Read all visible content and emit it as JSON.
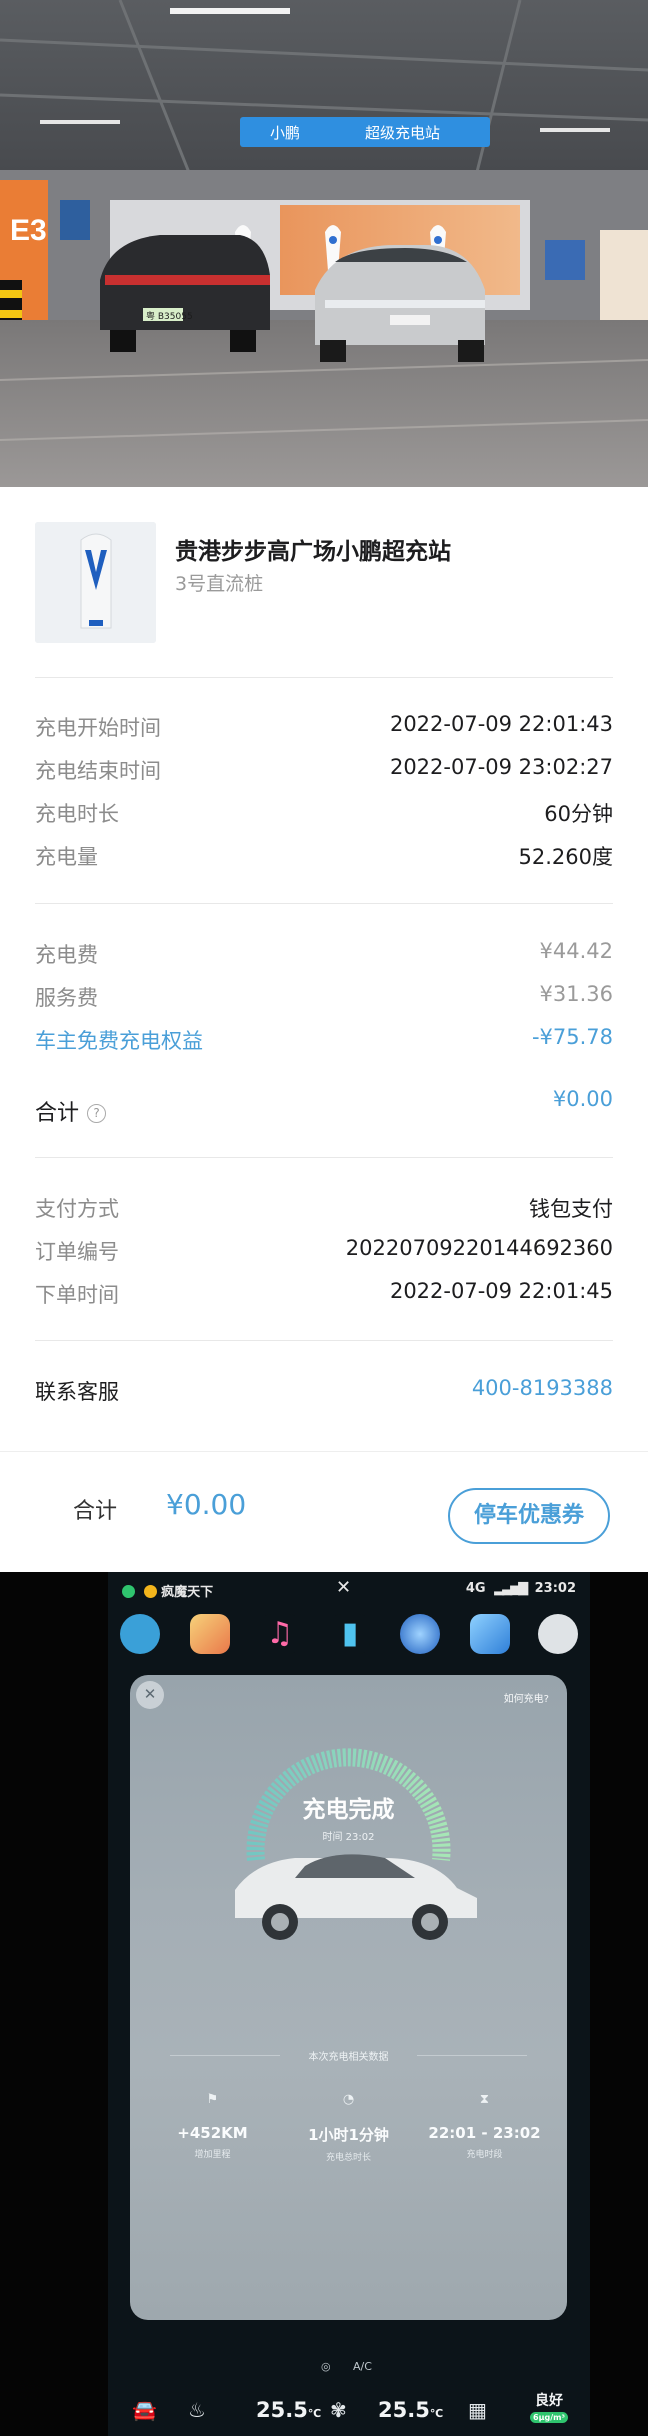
{
  "photo": {
    "brand_sign": "小鹏",
    "station_sign": "超级充电站",
    "bay_label": "E3",
    "license_plate": "粤 B35055"
  },
  "station": {
    "name": "贵港步步高广场小鹏超充站",
    "pile": "3号直流桩"
  },
  "charge": {
    "start_label": "充电开始时间",
    "start_value": "2022-07-09 22:01:43",
    "end_label": "充电结束时间",
    "end_value": "2022-07-09 23:02:27",
    "duration_label": "充电时长",
    "duration_value": "60分钟",
    "energy_label": "充电量",
    "energy_value": "52.260度"
  },
  "fees": {
    "charge_fee_label": "充电费",
    "charge_fee_value": "¥44.42",
    "service_fee_label": "服务费",
    "service_fee_value": "¥31.36",
    "benefit_label": "车主免费充电权益",
    "benefit_value": "-¥75.78",
    "total_label": "合计",
    "total_help_icon": "?",
    "total_value": "¥0.00"
  },
  "payment": {
    "method_label": "支付方式",
    "method_value": "钱包支付",
    "order_no_label": "订单编号",
    "order_no_value": "20220709220144692360",
    "order_time_label": "下单时间",
    "order_time_value": "2022-07-09 22:01:45"
  },
  "support": {
    "label": "联系客服",
    "phone": "400-8193388"
  },
  "bottom_bar": {
    "total_label": "合计",
    "total_amount": "¥0.00",
    "coupon_button": "停车优惠券"
  },
  "car_screen": {
    "status_left": "疯魔天下",
    "status_logo": "✕",
    "status_signal": "4G",
    "status_time": "23:02",
    "panel": {
      "close": "✕",
      "howto": "如何充电?",
      "title": "充电完成",
      "time": "时间 23:02",
      "section_title": "本次充电相关数据",
      "stats": [
        {
          "icon": "flag-icon",
          "glyph": "⚑",
          "value": "+452KM",
          "label": "增加里程"
        },
        {
          "icon": "clock-icon",
          "glyph": "◔",
          "value": "1小时1分钟",
          "label": "充电总时长"
        },
        {
          "icon": "hourglass-icon",
          "glyph": "⧗",
          "value": "22:01 - 23:02",
          "label": "充电时段"
        }
      ]
    },
    "climate": {
      "auto_label": "A/C",
      "left_temp": "25.5",
      "right_temp": "25.5",
      "temp_unit": "℃",
      "air_quality_value": "良好",
      "air_quality_badge": "6μg/m³"
    }
  },
  "colors": {
    "accent_blue": "#4a9fd8",
    "charge_ring_start": "#74c7c2",
    "charge_ring_end": "#a6e6b6",
    "aq_green": "#2fc46e"
  }
}
